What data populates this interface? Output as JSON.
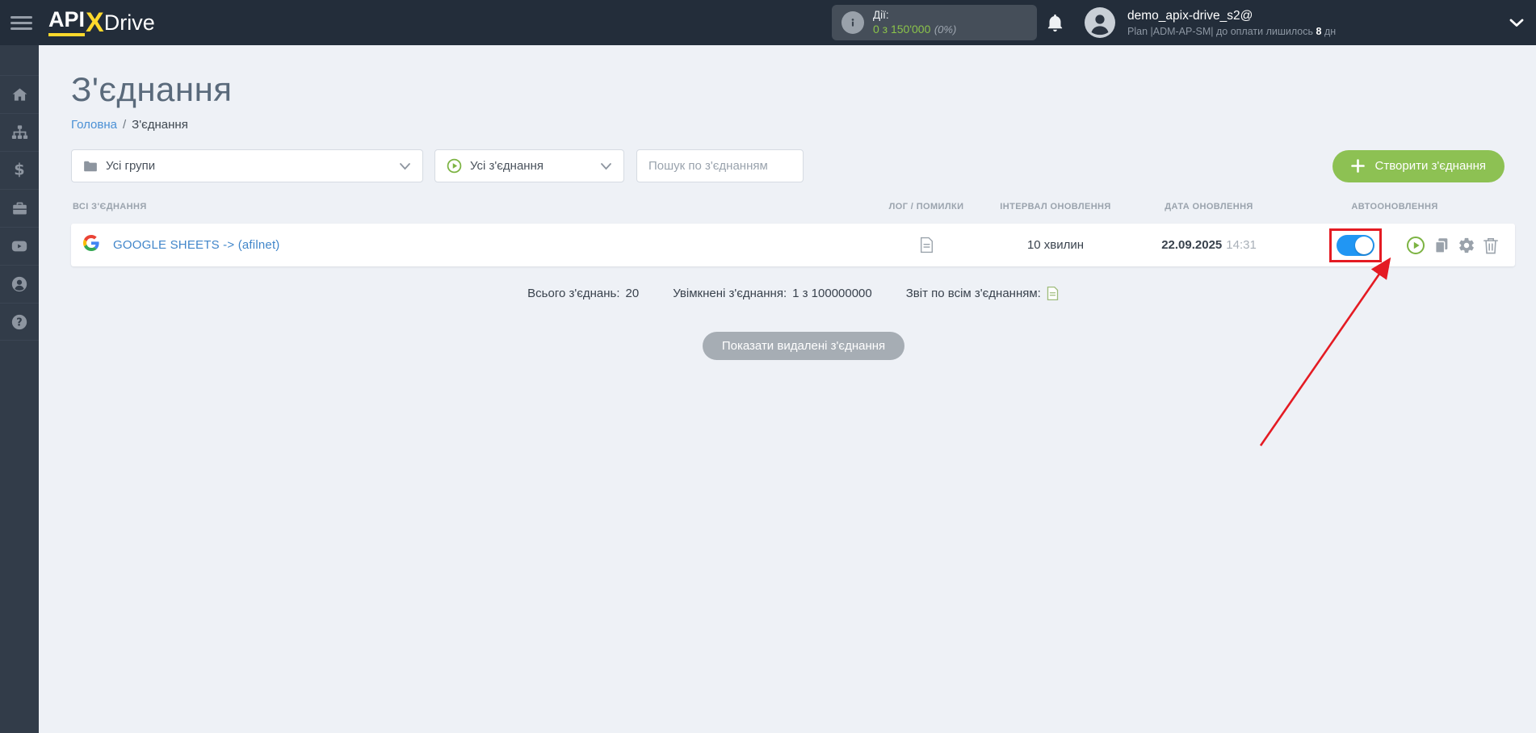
{
  "topbar": {
    "logo_api": "API",
    "logo_x": "X",
    "logo_drive": "Drive",
    "actions_widget": {
      "label": "Дії:",
      "usage": "0 з 150'000",
      "percent": "(0%)"
    },
    "user": {
      "name": "demo_apix-drive_s2@",
      "plan_prefix": "Plan |ADM-AP-SM| до оплати лишилось",
      "days": "8",
      "days_suffix": "дн"
    }
  },
  "page": {
    "title": "З'єднання",
    "breadcrumb_home": "Головна",
    "breadcrumb_sep": "/",
    "breadcrumb_current": "З'єднання"
  },
  "filters": {
    "groups": "Усі групи",
    "connections": "Усі з'єднання",
    "search_placeholder": "Пошук по з'єднанням",
    "create_button": "Створити з'єднання"
  },
  "table": {
    "headers": [
      "ВСІ З'ЄДНАННЯ",
      "ЛОГ / ПОМИЛКИ",
      "ІНТЕРВАЛ ОНОВЛЕННЯ",
      "ДАТА ОНОВЛЕННЯ",
      "АВТООНОВЛЕННЯ"
    ],
    "rows": [
      {
        "service_icon": "google-icon",
        "name": "GOOGLE SHEETS -> (afilnet)",
        "log_icon": "document-icon",
        "interval": "10 хвилин",
        "date": "22.09.2025",
        "time": "14:31",
        "autoupdate_enabled": true
      }
    ]
  },
  "summary": {
    "total_label": "Всього з'єднань:",
    "total_value": "20",
    "enabled_label": "Увімкнені з'єднання:",
    "enabled_value": "1 з 100000000",
    "report_label": "Звіт по всім з'єднанням:"
  },
  "footer": {
    "show_deleted_button": "Показати видалені з'єднання"
  },
  "sidebar_icons": [
    "home-icon",
    "structure-icon",
    "payments-icon",
    "services-icon",
    "video-icon",
    "account-icon",
    "help-icon"
  ],
  "colors": {
    "topbar_bg": "#232d3a",
    "sidebar_bg": "#323c49",
    "content_bg": "#eef1f6",
    "accent_green": "#8dc153",
    "link_blue": "#4186ca",
    "toggle_blue": "#2196f3",
    "annotation_red": "#e41b23"
  }
}
